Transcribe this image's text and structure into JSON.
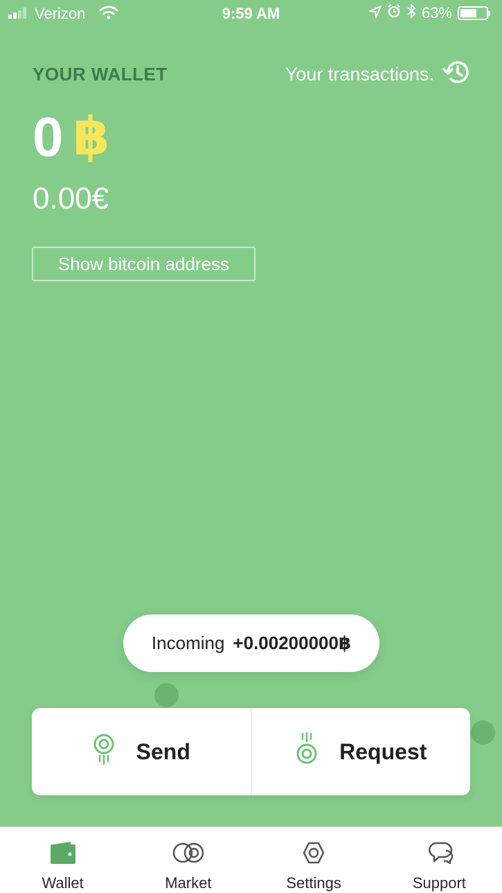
{
  "status_bar": {
    "carrier": "Verizon",
    "time": "9:59 AM",
    "battery": "63%",
    "battery_level": 0.63,
    "icons": [
      "signal-icon",
      "wifi-icon",
      "location-icon",
      "alarm-icon",
      "bluetooth-icon",
      "battery-icon"
    ]
  },
  "header": {
    "title": "YOUR WALLET",
    "transactions_link": "Your transactions.",
    "transactions_icon": "history-icon"
  },
  "balance": {
    "amount": "0",
    "currency_symbol": "฿",
    "fiat": "0.00€"
  },
  "address_button": {
    "label": "Show bitcoin address"
  },
  "incoming": {
    "label": "Incoming",
    "amount": "+0.00200000฿"
  },
  "actions": {
    "send": {
      "label": "Send",
      "icon": "send-icon"
    },
    "request": {
      "label": "Request",
      "icon": "request-icon"
    }
  },
  "tabs": [
    {
      "label": "Wallet",
      "icon": "wallet-icon",
      "active": true
    },
    {
      "label": "Market",
      "icon": "market-icon",
      "active": false
    },
    {
      "label": "Settings",
      "icon": "settings-icon",
      "active": false
    },
    {
      "label": "Support",
      "icon": "support-icon",
      "active": false
    }
  ],
  "colors": {
    "background": "#85cc8a",
    "title_green": "#3f7b48",
    "bitcoin_yellow": "#f6e65c",
    "accent_green": "#6cc27a"
  }
}
